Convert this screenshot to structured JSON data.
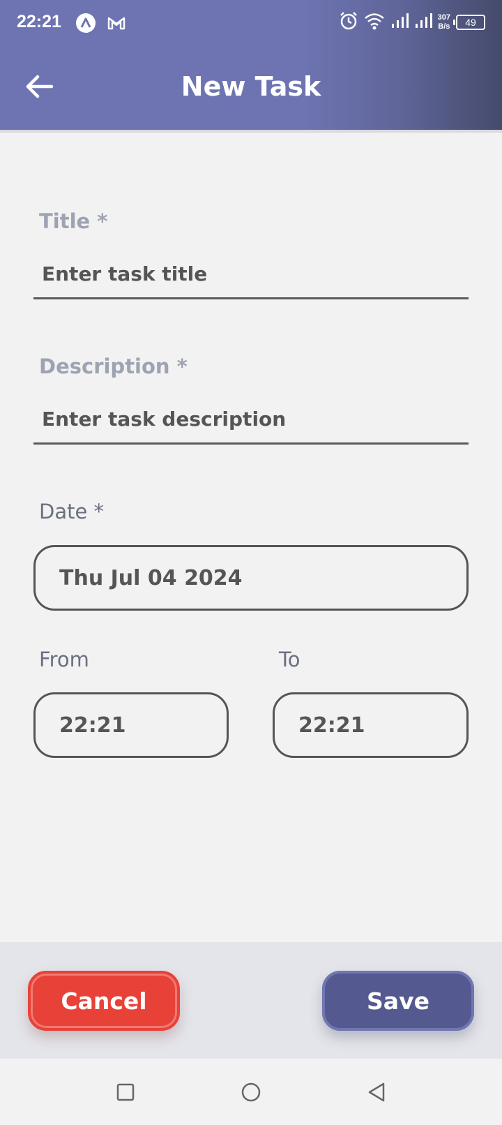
{
  "status_bar": {
    "time": "22:21",
    "net_speed_value": "307",
    "net_speed_unit": "B/s",
    "battery": "49",
    "left_icons": [
      "app-a-icon",
      "gmail-icon"
    ],
    "right_icons": [
      "alarm-icon",
      "wifi-icon",
      "signal-icon",
      "signal-icon-2"
    ]
  },
  "header": {
    "title": "New Task",
    "back_icon": "arrow-left-icon",
    "background_color": "#6e74b2"
  },
  "form": {
    "title_label": "Title *",
    "title_placeholder": "Enter task title",
    "description_label": "Description *",
    "description_placeholder": "Enter task description",
    "date_label": "Date *",
    "date_value": "Thu Jul 04 2024",
    "from_label": "From",
    "from_value": "22:21",
    "to_label": "To",
    "to_value": "22:21"
  },
  "footer": {
    "cancel_label": "Cancel",
    "save_label": "Save",
    "cancel_color": "#e84238",
    "save_color": "#545a8f"
  },
  "navbar": {
    "icons": [
      "recents-square-icon",
      "home-circle-icon",
      "back-triangle-icon"
    ]
  }
}
